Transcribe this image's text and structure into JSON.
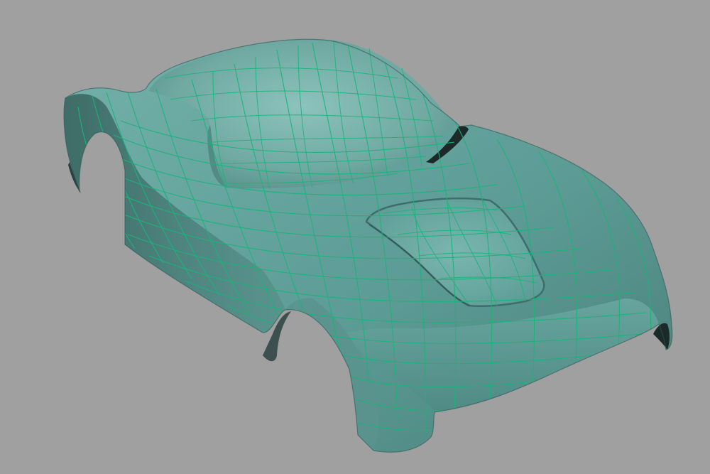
{
  "viewport": {
    "background_color": "#a0a0a0"
  },
  "model": {
    "kind": "car-body-shell",
    "display": "smooth-shaded-with-wireframe",
    "surface_color": "#5e9d97",
    "surface_highlight": "#86bdb6",
    "surface_shadow": "#3f6e6a",
    "wire_color": "#19b57a",
    "opening_color": "#1b2a28"
  }
}
